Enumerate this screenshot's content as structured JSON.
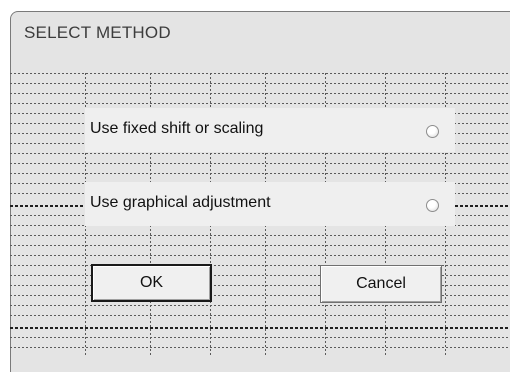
{
  "dialog": {
    "title": "SELECT METHOD",
    "options": [
      {
        "label": "Use fixed shift or scaling",
        "selected": false
      },
      {
        "label": "Use graphical adjustment",
        "selected": false
      }
    ],
    "buttons": {
      "ok_label": "OK",
      "cancel_label": "Cancel"
    }
  }
}
